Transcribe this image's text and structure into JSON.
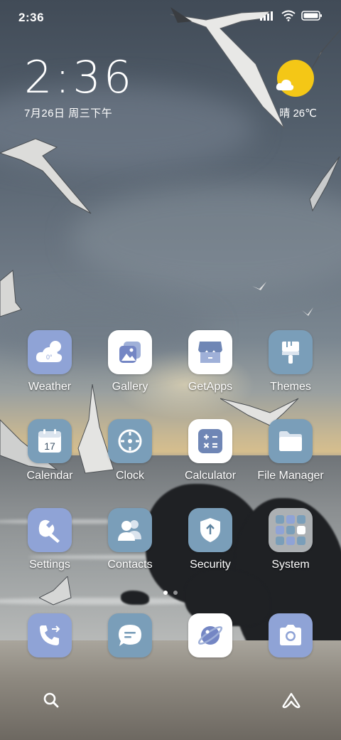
{
  "status_bar": {
    "time": "2:36"
  },
  "clock_widget": {
    "time": "2:36",
    "date": "7月26日 周三下午"
  },
  "weather_widget": {
    "summary": "晴 26℃"
  },
  "apps": [
    {
      "label": "Weather",
      "icon": "weather-icon",
      "color": "#8fa3d6"
    },
    {
      "label": "Gallery",
      "icon": "gallery-icon",
      "color": "#ffffff"
    },
    {
      "label": "GetApps",
      "icon": "store-icon",
      "color": "#ffffff"
    },
    {
      "label": "Themes",
      "icon": "brush-icon",
      "color": "#7a9eb9"
    },
    {
      "label": "Calendar",
      "icon": "calendar-icon",
      "color": "#7a9eb9"
    },
    {
      "label": "Clock",
      "icon": "clock-icon",
      "color": "#7a9eb9"
    },
    {
      "label": "Calculator",
      "icon": "calculator-icon",
      "color": "#ffffff"
    },
    {
      "label": "File Manager",
      "icon": "folder-icon",
      "color": "#7a9eb9"
    },
    {
      "label": "Settings",
      "icon": "wrench-icon",
      "color": "#8fa3d6"
    },
    {
      "label": "Contacts",
      "icon": "contacts-icon",
      "color": "#7a9eb9"
    },
    {
      "label": "Security",
      "icon": "shield-icon",
      "color": "#7a9eb9"
    },
    {
      "label": "System",
      "icon": "folder-grid-icon",
      "color": "#c6c9cc"
    }
  ],
  "weather_icon_text": "0°",
  "calendar_icon_day": "17",
  "dock": [
    {
      "name": "phone",
      "icon": "phone-icon",
      "color": "#8fa3d6"
    },
    {
      "name": "messages",
      "icon": "message-icon",
      "color": "#7a9eb9"
    },
    {
      "name": "browser",
      "icon": "planet-icon",
      "color": "#ffffff"
    },
    {
      "name": "camera",
      "icon": "camera-icon",
      "color": "#8fa3d6"
    }
  ],
  "bottom_bar": {
    "left": "search-icon",
    "right": "assistant-icon"
  },
  "page_indicator": {
    "pages": 2,
    "active": 1
  }
}
